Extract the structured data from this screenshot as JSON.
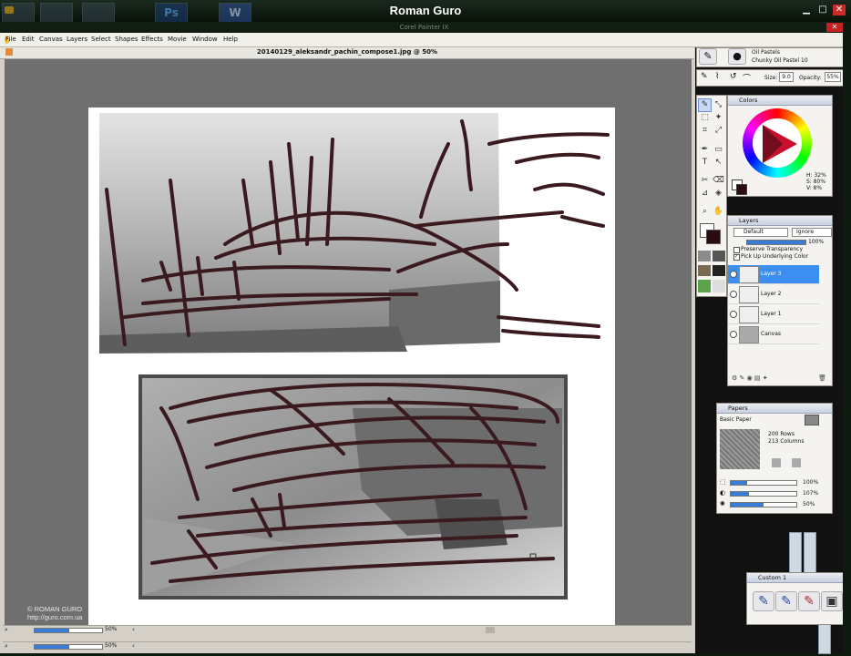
{
  "video": {
    "title": "Roman Guro"
  },
  "app": {
    "title": "Corel Painter IX",
    "menu": [
      "File",
      "Edit",
      "Canvas",
      "Layers",
      "Select",
      "Shapes",
      "Effects",
      "Movie",
      "Window",
      "Help"
    ],
    "document_title": "20140129_aleksandr_pachin_compose1.jpg @ 50%"
  },
  "brush_selector": {
    "category": "Oil Pastels",
    "variant": "Chunky Oil Pastel 10"
  },
  "property_bar": {
    "size_label": "Size:",
    "size_value": "9.0",
    "opacity_label": "Opacity:",
    "opacity_value": "55%"
  },
  "colors_panel": {
    "title": "Colors",
    "h": "H: 32%",
    "s": "S: 80%",
    "v": "V: 8%",
    "main_color": "#2a0c10",
    "secondary_color": "#ffffff"
  },
  "layers_panel": {
    "title": "Layers",
    "composite_method": "Default",
    "depth": "Ignore",
    "opacity": "100%",
    "preserve_transparency": "Preserve Transparency",
    "pick_up_underlying": "Pick Up Underlying Color",
    "layers": [
      {
        "name": "Layer 3",
        "selected": true
      },
      {
        "name": "Layer 2",
        "selected": false
      },
      {
        "name": "Layer 1",
        "selected": false
      },
      {
        "name": "Canvas",
        "selected": false
      }
    ]
  },
  "papers_panel": {
    "title": "Papers",
    "paper_name": "Basic Paper",
    "rows": "200 Rows",
    "columns": "213 Columns",
    "scale": "100%",
    "contrast": "107%",
    "brightness": "50%"
  },
  "custom_palette": {
    "title": "Custom 1"
  },
  "zoom": {
    "level": "50%",
    "level2": "50%"
  },
  "watermark": {
    "line1": "© ROMAN GURO",
    "line2": "http://guro.com.ua"
  },
  "colors": {
    "sketch": "#3a1a1f",
    "selection": "#3c8ef0"
  }
}
